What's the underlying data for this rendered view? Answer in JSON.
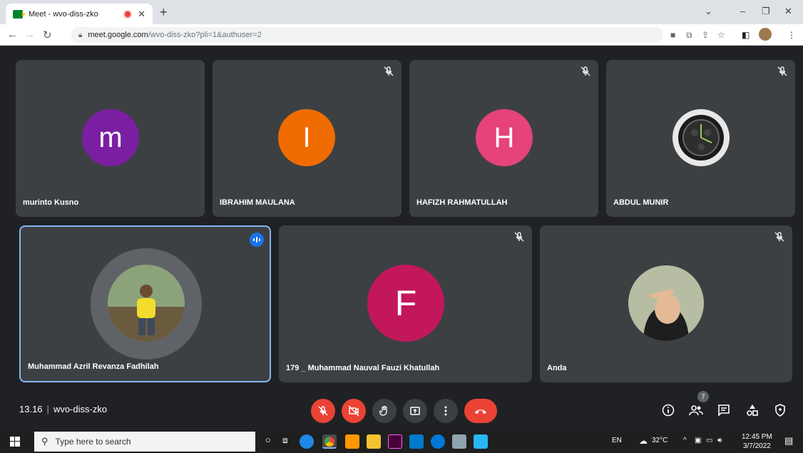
{
  "browser": {
    "tab_title": "Meet - wvo-diss-zko",
    "new_tab": "+",
    "url_host": "meet.google.com",
    "url_path": "/wvo-diss-zko?pli=1&authuser=2"
  },
  "participants": [
    {
      "name": "murinto Kusno",
      "initial": "m",
      "color": "#7b1fa2"
    },
    {
      "name": "IBRAHIM MAULANA",
      "initial": "I",
      "color": "#ef6c00"
    },
    {
      "name": "HAFIZH RAHMATULLAH",
      "initial": "H",
      "color": "#e5437a"
    },
    {
      "name": "ABDUL MUNIR",
      "initial": "",
      "color": "#2b2b2b"
    },
    {
      "name": "Muhammad Azril Revanza Fadhilah",
      "initial": "",
      "color": "#6e8b5a"
    },
    {
      "name": "179 _ Muhammad Nauval Fauzi Khatullah",
      "initial": "F",
      "color": "#c2185b"
    },
    {
      "name": "Anda",
      "initial": "",
      "color": "#8a8f7c"
    }
  ],
  "meeting": {
    "time": "13.16",
    "separator": "|",
    "code": "wvo-diss-zko",
    "people_count": "7"
  },
  "taskbar": {
    "search_placeholder": "Type here to search",
    "lang": "EN",
    "weather": "32°C",
    "clock_time": "12:45 PM",
    "clock_date": "3/7/2022"
  }
}
